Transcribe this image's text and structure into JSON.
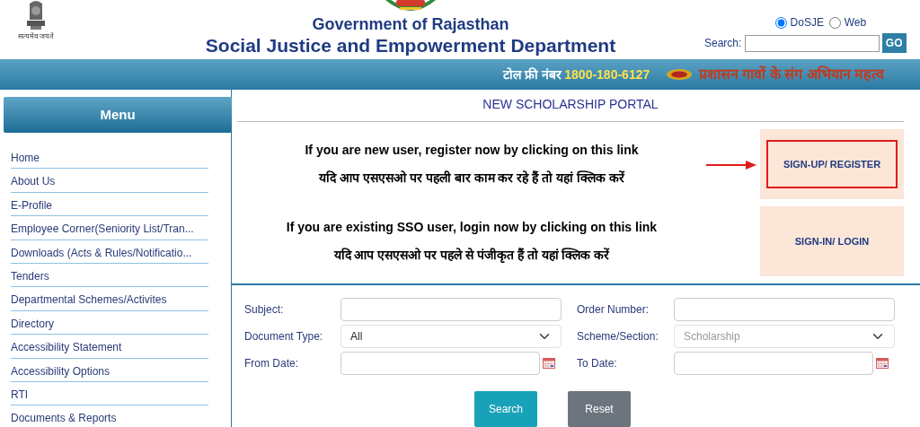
{
  "header": {
    "emblem_caption": "सत्यमेव जयते",
    "title": "Government of Rajasthan",
    "subtitle": "Social Justice and Empowerment Department",
    "search": {
      "options": [
        {
          "label": "DoSJE",
          "selected": true
        },
        {
          "label": "Web",
          "selected": false
        }
      ],
      "label": "Search:",
      "button": "GO"
    }
  },
  "banner": {
    "tollfree_label": "टोल फ्री नंबर",
    "tollfree_number": "1800-180-6127",
    "campaign": "प्रशासन गावों के संग अभियान महत्व"
  },
  "menu": {
    "title": "Menu",
    "items": [
      "Home",
      "About Us",
      "E-Profile",
      "Employee Corner(Seniority List/Tran...",
      "Downloads (Acts & Rules/Notificatio...",
      "Tenders",
      "Departmental Schemes/Activites",
      "Directory",
      "Accessibility Statement",
      "Accessibility Options",
      "RTI",
      "Documents & Reports"
    ]
  },
  "portal": {
    "title": "NEW SCHOLARSHIP PORTAL",
    "blocks": [
      {
        "lines": [
          "If you are new user, register now by clicking on this link",
          "यदि आप एसएसओ पर पहली बार काम कर रहे हैं तो यहां क्लिक करें"
        ],
        "button": "SIGN-UP/ REGISTER",
        "highlighted": true
      },
      {
        "lines": [
          "If you are existing SSO user, login now by clicking on this link",
          "यदि आप एसएसओ पर पहले से पंजीकृत हैं तो यहां क्लिक करें"
        ],
        "button": "SIGN-IN/ LOGIN",
        "highlighted": false
      }
    ]
  },
  "form": {
    "fields": [
      {
        "label": "Subject:",
        "kind": "text",
        "disabled": false
      },
      {
        "label": "Order Number:",
        "kind": "text",
        "disabled": false
      },
      {
        "label": "Document Type:",
        "kind": "select",
        "value": "All",
        "disabled": false
      },
      {
        "label": "Scheme/Section:",
        "kind": "select",
        "value": "Scholarship",
        "disabled": true
      },
      {
        "label": "From Date:",
        "kind": "date",
        "disabled": false
      },
      {
        "label": "To Date:",
        "kind": "date",
        "disabled": false
      }
    ],
    "buttons": [
      {
        "label": "Search",
        "kind": "primary"
      },
      {
        "label": "Reset",
        "kind": "secondary"
      }
    ]
  }
}
